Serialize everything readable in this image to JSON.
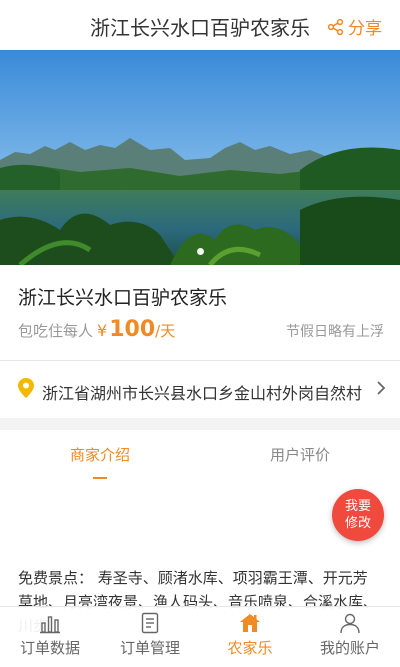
{
  "header": {
    "title": "浙江长兴水口百驴农家乐",
    "share_label": "分享"
  },
  "listing": {
    "name": "浙江长兴水口百驴农家乐",
    "price_prefix": "包吃住每人",
    "currency": "¥",
    "price": "100",
    "unit": "/天",
    "holiday_note": "节假日略有上浮"
  },
  "address": {
    "text": "浙江省湖州市长兴县水口乡金山村外岗自然村"
  },
  "tabs": {
    "intro": "商家介绍",
    "reviews": "用户评价"
  },
  "fab": {
    "line1": "我要",
    "line2": "修改"
  },
  "description": "免费景点：  寿圣寺、顾渚水库、项羽霸王潭、开元芳草地、月亮湾夜景、渔人码头、音乐喷泉、合溪水库、川步",
  "tabbar": {
    "items": [
      {
        "label": "订单数据",
        "icon": "bar-chart-icon"
      },
      {
        "label": "订单管理",
        "icon": "document-icon"
      },
      {
        "label": "农家乐",
        "icon": "farmhouse-icon"
      },
      {
        "label": "我的账户",
        "icon": "user-icon"
      }
    ]
  },
  "colors": {
    "accent": "#f08a24",
    "fab": "#ef4a3d"
  }
}
